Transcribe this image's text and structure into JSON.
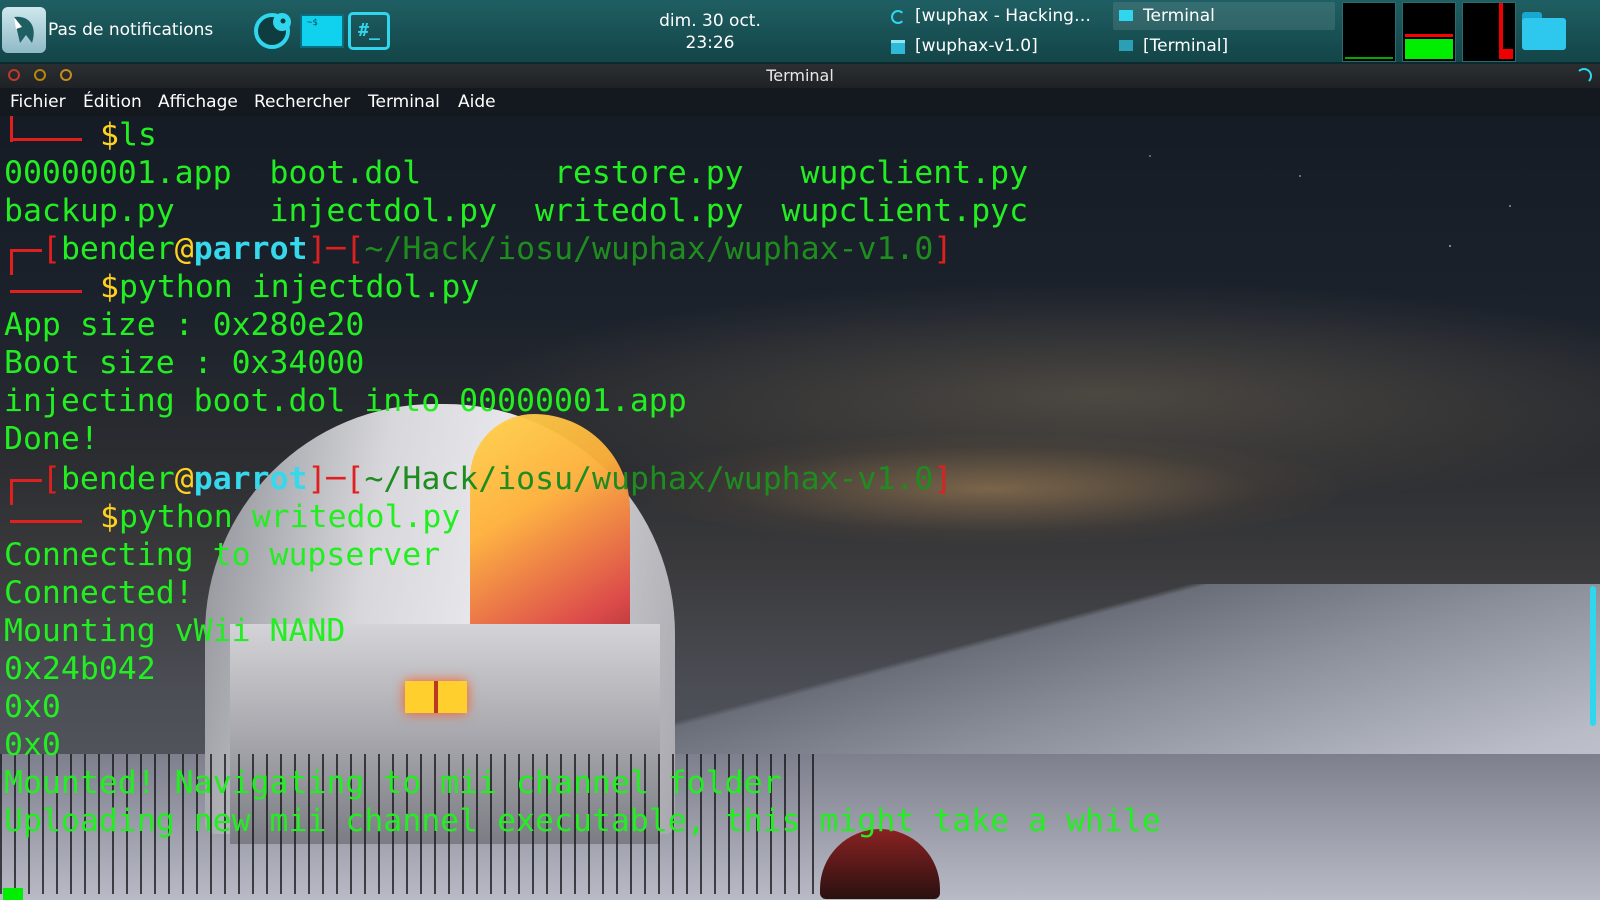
{
  "panel": {
    "notifications": "Pas de notifications",
    "launcher_root_label": "#_",
    "launcher_term_label": "~$",
    "clock_date": "dim. 30 oct.",
    "clock_time": "23:26",
    "tasks": [
      {
        "label": "[wuphax - Hacking…",
        "icon": "reload-icon"
      },
      {
        "label": "Terminal",
        "icon": "terminal-window-icon"
      },
      {
        "label": "[wuphax-v1.0]",
        "icon": "folder-icon"
      },
      {
        "label": "[Terminal]",
        "icon": "terminal-window-icon"
      }
    ]
  },
  "window": {
    "title": "Terminal",
    "menu": [
      "Fichier",
      "Édition",
      "Affichage",
      "Rechercher",
      "Terminal",
      "Aide"
    ]
  },
  "terminal": {
    "prompt": {
      "user": "bender",
      "at": "@",
      "host": "parrot",
      "path": "~/Hack/iosu/wuphax/wuphax-v1.0",
      "symbol": "$"
    },
    "cmd_ls": "ls",
    "ls_row1": "00000001.app  boot.dol       restore.py   wupclient.py",
    "ls_row2": "backup.py     injectdol.py  writedol.py  wupclient.pyc",
    "cmd_inject": "python injectdol.py",
    "inject_output": [
      "App size : 0x280e20",
      "Boot size : 0x34000",
      "injecting boot.dol into 00000001.app",
      "Done!"
    ],
    "cmd_write": "python writedol.py",
    "write_output": [
      "Connecting to wupserver",
      "Connected!",
      "Mounting vWii NAND",
      "0x24b042",
      "0x0",
      "0x0",
      "Mounted! Navigating to mii channel folder",
      "Uploading new mii channel executable, this might take a while"
    ]
  },
  "colors": {
    "panel_bg": "#1a5256",
    "terminal_green": "#22ee22",
    "prompt_red": "#e0201e",
    "prompt_yellow": "#ffd21e",
    "prompt_cyan": "#36d8ec",
    "accent_cyan": "#2fd6ee"
  }
}
